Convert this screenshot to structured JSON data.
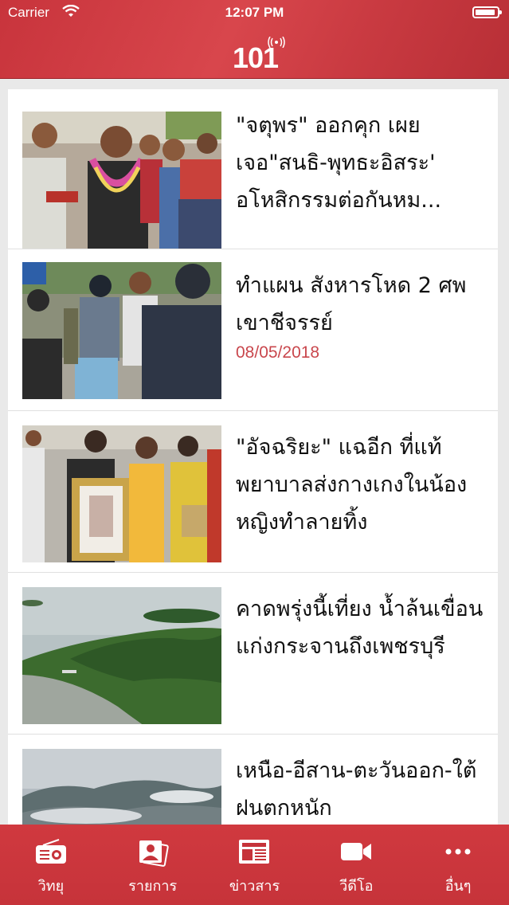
{
  "status_bar": {
    "carrier": "Carrier",
    "time": "12:07 PM"
  },
  "header": {
    "logo": "101"
  },
  "articles": [
    {
      "title": "\"จตุพร\" ออกคุก เผยเจอ\"สนธิ-พุทธะอิสระ' อโหสิกรรมต่อกันหม...",
      "date": ""
    },
    {
      "title": "ทำแผน สังหารโหด 2 ศพ เขาชีจรรย์",
      "date": "08/05/2018"
    },
    {
      "title": "\"อัจฉริยะ\" แฉอีก ที่แท้พยาบาลส่งกางเกงในน้องหญิงทำลายทิ้ง",
      "date": ""
    },
    {
      "title": "คาดพรุ่งนี้เที่ยง น้ำล้นเขื่อนแก่งกระจานถึงเพชรบุรี",
      "date": ""
    },
    {
      "title": "เหนือ-อีสาน-ตะวันออก-ใต้ ฝนตกหนัก",
      "date": ""
    }
  ],
  "tabs": [
    {
      "label": "วิทยุ",
      "icon": "radio-icon"
    },
    {
      "label": "รายการ",
      "icon": "programs-icon"
    },
    {
      "label": "ข่าวสาร",
      "icon": "newspaper-icon"
    },
    {
      "label": "วีดีโอ",
      "icon": "video-icon"
    },
    {
      "label": "อื่นๆ",
      "icon": "more-icon"
    }
  ]
}
